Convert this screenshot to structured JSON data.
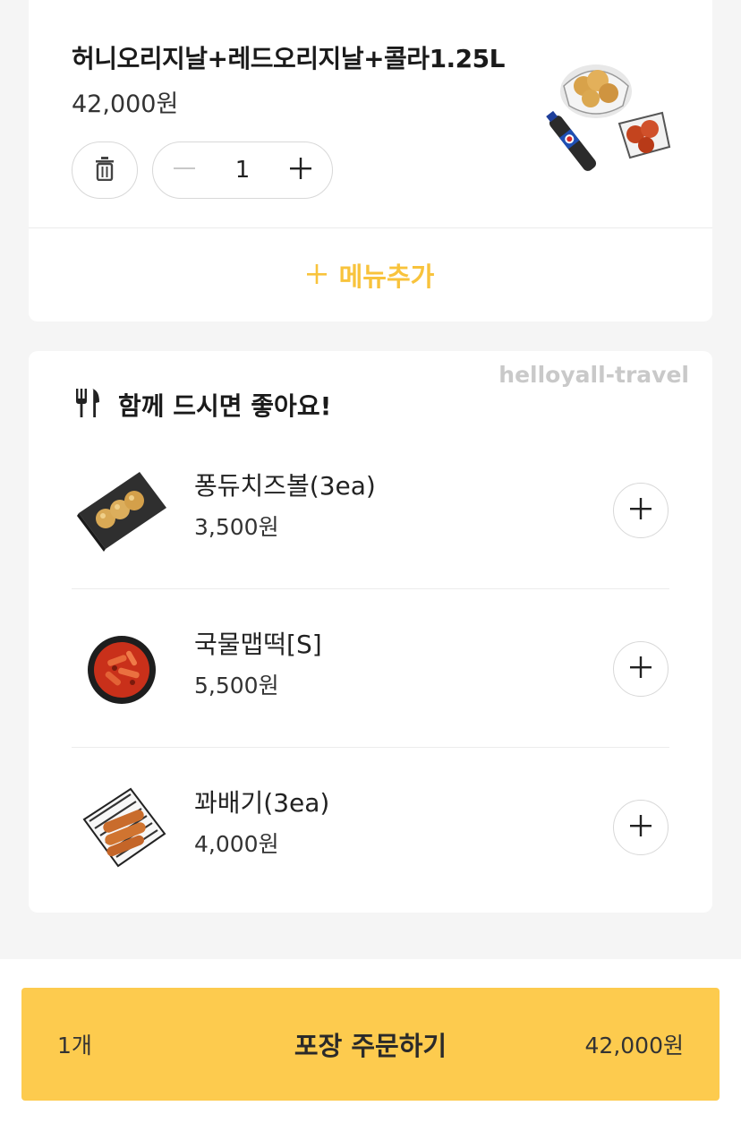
{
  "cart": {
    "item": {
      "name": "허니오리지날+레드오리지날+콜라1.25L",
      "price": "42,000원",
      "quantity": "1",
      "image_icon": "chicken-combo-image"
    },
    "add_menu_label": "메뉴추가"
  },
  "recommend": {
    "title": "함께 드시면 좋아요!",
    "watermark": "helloyall-travel",
    "items": [
      {
        "name": "퐁듀치즈볼(3ea)",
        "price": "3,500원",
        "image_icon": "cheese-ball-image"
      },
      {
        "name": "국물맵떡[S]",
        "price": "5,500원",
        "image_icon": "tteokbokki-image"
      },
      {
        "name": "꽈배기(3ea)",
        "price": "4,000원",
        "image_icon": "twisted-donut-image"
      }
    ]
  },
  "order": {
    "count": "1개",
    "label": "포장 주문하기",
    "total": "42,000원"
  },
  "colors": {
    "accent": "#fdcb4e",
    "add_menu_text": "#f8c33c",
    "background": "#f5f5f5"
  }
}
